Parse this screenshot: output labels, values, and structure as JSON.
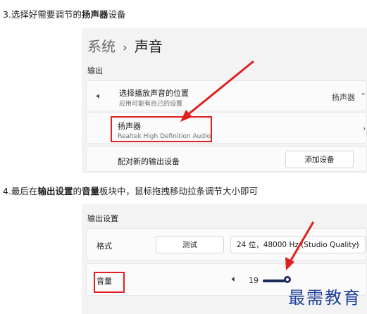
{
  "step1": {
    "prefix": "3.选择好需要调节的",
    "bold": "扬声器",
    "suffix": "设备"
  },
  "step2": {
    "prefix": "4.最后在",
    "bold1": "输出设置",
    "mid": "的",
    "bold2": "音量",
    "suffix": "板块中，鼠标拖拽移动拉条调节大小即可"
  },
  "shot1": {
    "breadcrumb": {
      "parent": "系统",
      "separator": "›",
      "current": "声音"
    },
    "output_header": "输出",
    "choose_row": {
      "title": "选择播放声音的位置",
      "subtitle": "应用可能有自己的设置",
      "value": "扬声器",
      "icon": "speaker-icon"
    },
    "speaker_row": {
      "title": "扬声器",
      "subtitle": "Realtek High Definition Audio"
    },
    "pair_row": {
      "label": "配对新的输出设备",
      "button": "添加设备"
    }
  },
  "shot2": {
    "header": "输出设置",
    "format_row": {
      "label": "格式",
      "test_button": "测试",
      "format_value": "24 位，48000 Hz (Studio Quality)"
    },
    "volume_row": {
      "label": "音量",
      "value": "19",
      "icon": "speaker-icon"
    }
  },
  "watermark": "最需教育",
  "colors": {
    "highlight": "#e02020",
    "slider": "#1f2d5a",
    "watermark": "#1e3f9a"
  }
}
